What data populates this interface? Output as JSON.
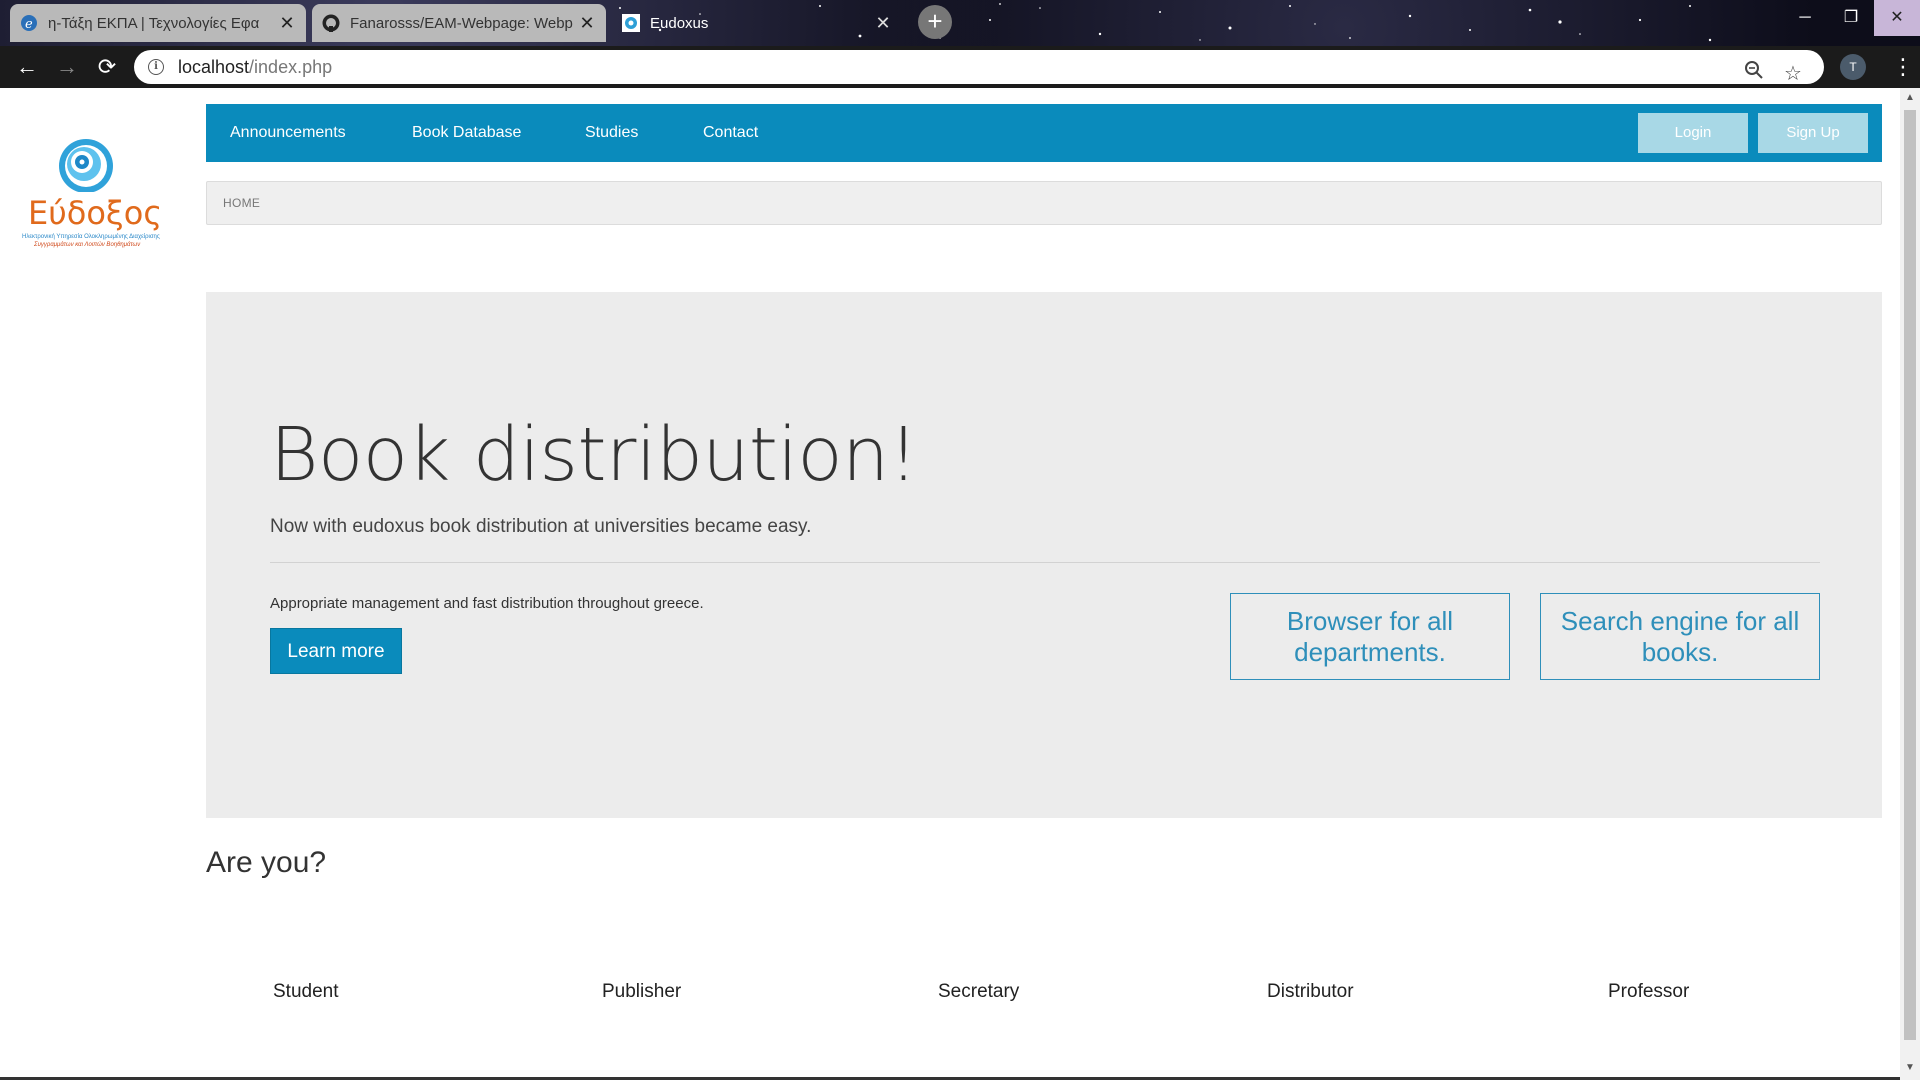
{
  "browser": {
    "tabs": [
      {
        "title": "η-Τάξη ΕΚΠΑ | Τεχνολογίες Εφα",
        "active": false,
        "icon": "eclass-icon"
      },
      {
        "title": "Fanarosss/EAM-Webpage: Webp",
        "active": false,
        "icon": "github-icon"
      },
      {
        "title": "Eudoxus",
        "active": true,
        "icon": "eudoxus-icon"
      }
    ],
    "new_tab": "+",
    "url_host": "localhost",
    "url_path": "/index.php",
    "profile_initial": "T"
  },
  "site": {
    "logo": {
      "name": "Εύδοξος",
      "subtitle_line1": "Ηλεκτρονική Υπηρεσία Ολοκληρωμένης Διαχείρισης",
      "subtitle_line2": "Συγγραμμάτων και Λοιπών Βοηθημάτων"
    },
    "nav": {
      "items": [
        "Announcements",
        "Book Database",
        "Studies",
        "Contact"
      ],
      "login": "Login",
      "signup": "Sign Up"
    },
    "breadcrumb": "HOME",
    "hero": {
      "title": "Book distribution!",
      "lead": "Now with eudoxus book distribution at universities became easy.",
      "paragraph": "Appropriate management and fast distribution throughout greece.",
      "button": "Learn more",
      "features": [
        "Browser for all departments.",
        "Search engine for all books."
      ]
    },
    "roles_heading": "Are you?",
    "roles": [
      "Student",
      "Publisher",
      "Secretary",
      "Distributor",
      "Professor"
    ]
  },
  "colors": {
    "nav_bg": "#0a8bbc",
    "nav_button_bg": "#a8d8e6",
    "hero_bg": "#ececec",
    "accent_text": "#2e8fba"
  }
}
